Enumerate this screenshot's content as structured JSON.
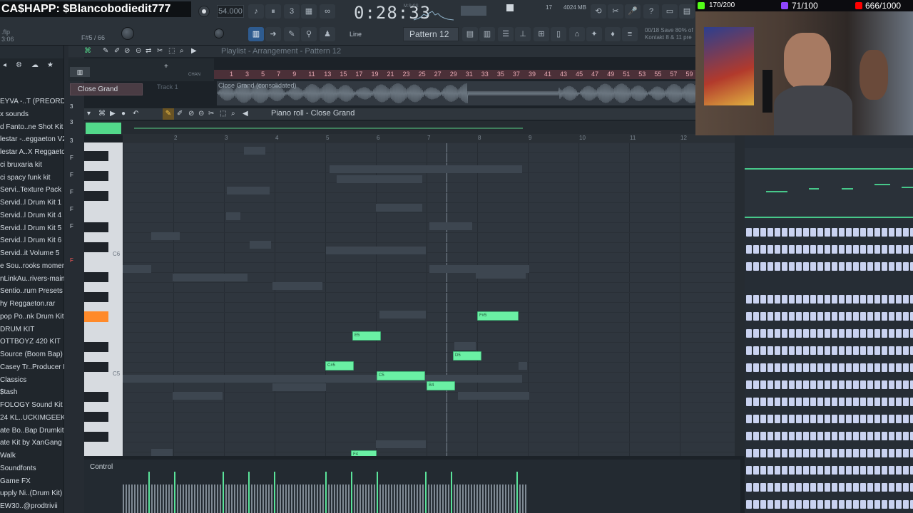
{
  "topbar": {
    "cashapp": "CA$HAPP: $Blancobodiedit777",
    "project_file": ".flp",
    "project_time": "3:06",
    "hint_note": "F#5 / 66",
    "tempo": "54.000",
    "song_time": "0:28:33",
    "song_time_label": "M:S:CS",
    "polyphony": "17",
    "memory": "4024 MB",
    "memory_sub": "0",
    "tool_mode": "Line",
    "pattern": "Pattern 12",
    "save_note_1": "00/18  Save 80% of",
    "save_note_2": "Kontakt 8 & 11 pre"
  },
  "browser": {
    "items": [
      "EYVA -..T (PREORDER)",
      "x sounds",
      "d Fanto..ne Shot Kit",
      "lestar -..eggaeton V2",
      "lestar A..X Reggaeton",
      "ci bruxaria kit",
      "ci spacy funk kit",
      "Servi..Texture Pack",
      "Servid..l Drum Kit 1",
      "Servid..l Drum Kit 4",
      "Servid..l Drum Kit 5",
      "Servid..l Drum Kit 6",
      "Servid..it Volume 5",
      "e Sou..rooks moment",
      "nLinkAu..rivers-main",
      "Sentio..rum Presets",
      "hy Reggaeton.rar",
      "pop Po..nk Drum Kit",
      "DRUM KIT",
      "OTTBOYZ 420 KIT",
      "Source (Boom Bap)",
      "Casey Tr..Producer Kit",
      "Classics",
      "$tash",
      "FOLOGY Sound Kit",
      "24 KL..UCKIMGEEKED",
      "ate Bo..Bap Drumkit",
      "ate Kit by XanGang",
      "Walk",
      "Soundfonts",
      "Game FX",
      "upply Ni..(Drum Kit)",
      "EW30..@prodtrivii"
    ]
  },
  "channels": [
    "3",
    "3",
    "3",
    "F",
    "F",
    "F",
    "F",
    "F",
    "F"
  ],
  "playlist": {
    "title": "Playlist - Arrangement - Pattern 12",
    "timeline": [
      "1",
      "3",
      "5",
      "7",
      "9",
      "11",
      "13",
      "15",
      "17",
      "19",
      "21",
      "23",
      "25",
      "27",
      "29",
      "31",
      "33",
      "35",
      "37",
      "39",
      "41",
      "43",
      "45",
      "47",
      "49",
      "51",
      "53",
      "55",
      "57",
      "59",
      "61"
    ],
    "channel_name": "Close Grand",
    "track_label": "Track 1",
    "clip_name": "Close Grand (consolidated)"
  },
  "piano_roll": {
    "title": "Piano roll - Close Grand",
    "ruler": [
      "2",
      "3",
      "4",
      "5",
      "6",
      "7",
      "8",
      "9",
      "10",
      "11",
      "12"
    ],
    "key_labels": [
      "C6",
      "C5"
    ],
    "notes": [
      {
        "label": "F#5"
      },
      {
        "label": "E5"
      },
      {
        "label": "D5"
      },
      {
        "label": "C#5"
      },
      {
        "label": "C5"
      },
      {
        "label": "B4"
      },
      {
        "label": "F4"
      }
    ],
    "control_label": "Control"
  },
  "stream": {
    "kick_viewers": "170/200",
    "twitch_goal": "71/100",
    "youtube_goal": "666/1000",
    "kick_color": "#53fc18",
    "twitch_color": "#9146ff",
    "youtube_color": "#ff0000"
  },
  "colors": {
    "note": "#6af0a4",
    "accent_key": "#ff8a2a",
    "playlist_timeline": "#4b3038"
  }
}
